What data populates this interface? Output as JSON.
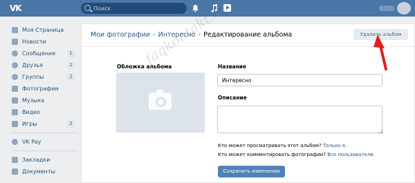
{
  "header": {
    "logo": "VK",
    "search_placeholder": "Поиск",
    "notifications_count": "",
    "icons": [
      "bell-icon",
      "music-icon",
      "play-icon"
    ],
    "accent": "#4a76a8"
  },
  "sidebar": {
    "items": [
      {
        "label": "Моя Страница",
        "count": "",
        "icon": "home-icon"
      },
      {
        "label": "Новости",
        "count": "",
        "icon": "news-icon"
      },
      {
        "label": "Сообщения",
        "count": "1",
        "icon": "chat-icon"
      },
      {
        "label": "Друзья",
        "count": "1",
        "icon": "friends-icon"
      },
      {
        "label": "Группы",
        "count": "2",
        "icon": "groups-icon"
      },
      {
        "label": "Фотографии",
        "count": "",
        "icon": "camera-icon"
      },
      {
        "label": "Музыка",
        "count": "",
        "icon": "music-icon"
      },
      {
        "label": "Видео",
        "count": "",
        "icon": "video-icon"
      },
      {
        "label": "Игры",
        "count": "2",
        "icon": "games-icon"
      }
    ],
    "pay": {
      "label": "VK Pay",
      "icon": "vkpay-icon"
    },
    "extra": [
      {
        "label": "Закладки",
        "icon": "star-icon"
      },
      {
        "label": "Документы",
        "icon": "docs-icon"
      }
    ]
  },
  "main": {
    "breadcrumb": [
      "Мои фотографии",
      "Интересно",
      "Редактирование альбома"
    ],
    "delete_button": "Удалить альбом",
    "cover_label": "Обложка альбома",
    "name_label": "Название",
    "name_value": "Интересно",
    "desc_label": "Описание",
    "desc_value": "",
    "view_question": "Кто может просматривать этот альбом?",
    "view_value": "Только я.",
    "comment_question": "Кто может комментировать фотографии?",
    "comment_value": "Все пользователи.",
    "save_button": "Сохранить изменения"
  },
  "watermark": "faqkontakt.ru",
  "colors": {
    "link": "#2a5885",
    "button": "#5181b8",
    "arrow": "#e02020"
  }
}
